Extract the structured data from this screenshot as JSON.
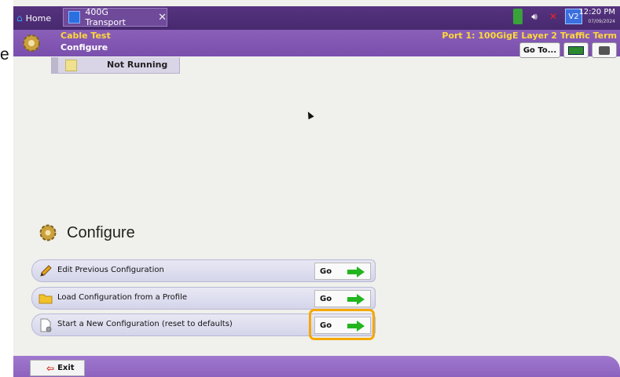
{
  "left_crop_letter": "e",
  "topbar": {
    "home_tab": "Home",
    "active_tab": "400G Transport",
    "clock_time": "12:20 PM",
    "clock_date": "07/09/2024",
    "status_icons": [
      "battery-icon",
      "speaker-icon",
      "mute-icon",
      "v2-icon"
    ]
  },
  "header": {
    "mode": "Cable Test",
    "screen": "Configure",
    "port": "Port 1: 100GigE Layer 2 Traffic Term",
    "goto_label": "Go To..."
  },
  "state": {
    "text": "Not Running"
  },
  "configure": {
    "title": "Configure",
    "rows": [
      {
        "label": "Edit Previous Configuration",
        "go": "Go",
        "icon": "pencil-icon"
      },
      {
        "label": "Load Configuration from a Profile",
        "go": "Go",
        "icon": "folder-icon"
      },
      {
        "label": "Start a New Configuration (reset to defaults)",
        "go": "Go",
        "icon": "new-file-icon"
      }
    ]
  },
  "bottom": {
    "exit_label": "Exit"
  },
  "colors": {
    "topbar": "#4f2f7e",
    "header": "#7a4fad",
    "mode_text": "#ffd83a",
    "go_arrow": "#22b51f",
    "highlight": "#f5a800"
  }
}
